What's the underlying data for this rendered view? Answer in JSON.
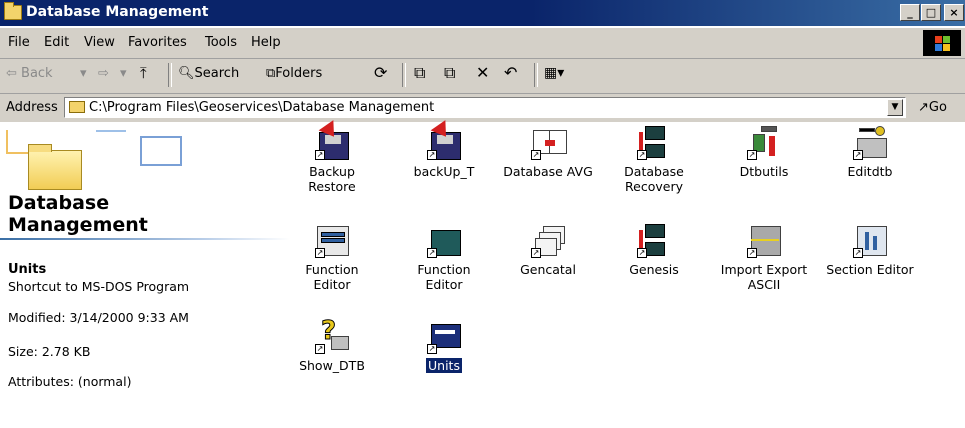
{
  "window": {
    "title": "Database Management"
  },
  "title_buttons": {
    "minimize": "_",
    "maximize": "□",
    "close": "×"
  },
  "menu": [
    "File",
    "Edit",
    "View",
    "Favorites",
    "Tools",
    "Help"
  ],
  "toolbar": {
    "back": "⇦ Back",
    "back_drop": "▾",
    "forward": "⇨",
    "forward_drop": "▾",
    "up": "⤒",
    "search": "Search",
    "folders": "Folders",
    "history": "⟳",
    "move_to": "⧉",
    "copy_to": "⧉",
    "delete": "✕",
    "undo": "↶",
    "views": "▦▾"
  },
  "address": {
    "label": "Address",
    "path": "C:\\Program Files\\Geoservices\\Database Management",
    "go": "Go",
    "dropdown": "▼"
  },
  "left_pane": {
    "title_line1": "Database",
    "title_line2": "Management",
    "selected_name": "Units",
    "type": "Shortcut to MS-DOS Program",
    "modified": "Modified: 3/14/2000 9:33 AM",
    "size": "Size: 2.78 KB",
    "attributes": "Attributes: (normal)"
  },
  "icons": [
    {
      "line1": "Backup",
      "line2": "Restore",
      "glyph": "floppy-red-arrow-icon"
    },
    {
      "line1": "backUp_T",
      "line2": "",
      "glyph": "floppy-red-arrow-icon"
    },
    {
      "line1": "Database AVG",
      "line2": "",
      "glyph": "document-stack-icon"
    },
    {
      "line1": "Database",
      "line2": "Recovery",
      "glyph": "rtm-tdc-icon"
    },
    {
      "line1": "Dtbutils",
      "line2": "",
      "glyph": "tools-icon"
    },
    {
      "line1": "Editdtb",
      "line2": "",
      "glyph": "edit-scissors-icon"
    },
    {
      "line1": "Function",
      "line2": "Editor",
      "glyph": "grid-window-icon"
    },
    {
      "line1": "Function",
      "line2": "Editor",
      "glyph": "terminal-icon"
    },
    {
      "line1": "Gencatal",
      "line2": "",
      "glyph": "catalog-stack-icon"
    },
    {
      "line1": "Genesis",
      "line2": "",
      "glyph": "rtm-tdc-icon"
    },
    {
      "line1": "Import Export",
      "line2": "ASCII",
      "glyph": "import-export-arrows-icon"
    },
    {
      "line1": "Section Editor",
      "line2": "",
      "glyph": "section-chart-icon"
    },
    {
      "line1": "Show_DTB",
      "line2": "",
      "glyph": "question-printer-icon"
    },
    {
      "line1": "Units",
      "line2": "",
      "glyph": "units-window-icon",
      "selected": true
    }
  ],
  "colors": {
    "titlebar": "#0a246a",
    "selection": "#0a246a",
    "chrome": "#d4d0c8"
  }
}
